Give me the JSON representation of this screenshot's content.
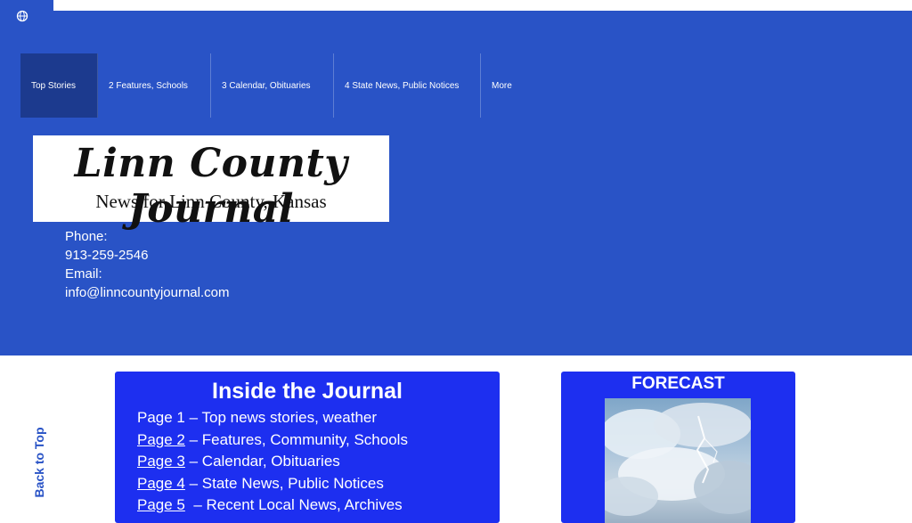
{
  "nav": {
    "items": [
      {
        "label": "Top Stories"
      },
      {
        "label": "2 Features, Schools"
      },
      {
        "label": "3 Calendar, Obituaries"
      },
      {
        "label": "4 State News, Public Notices"
      },
      {
        "label": "More"
      }
    ]
  },
  "logo": {
    "title": "Linn County Journal",
    "subtitle": "News for Linn County, Kansas"
  },
  "contact": {
    "phone_label": "Phone:",
    "phone": "913-259-2546",
    "email_label": "Email:",
    "email": "info@linncountyjournal.com"
  },
  "back_to_top": "Back to Top",
  "inside": {
    "title": "Inside the Journal",
    "pages": [
      {
        "link": "Page 1",
        "text": " – Top news stories, weather"
      },
      {
        "link": "Page 2",
        "text": " – Features, Community, Schools"
      },
      {
        "link": "Page 3",
        "text": " – Calendar, Obituaries"
      },
      {
        "link": "Page 4",
        "text": " – State News, Public Notices"
      },
      {
        "link": "Page 5",
        "text": "  – Recent Local News, Archives"
      }
    ]
  },
  "forecast": {
    "title": "FORECAST"
  },
  "colors": {
    "header_blue": "#2953c6",
    "nav_active": "#1c3a8e",
    "box_blue": "#1d2ff0"
  }
}
